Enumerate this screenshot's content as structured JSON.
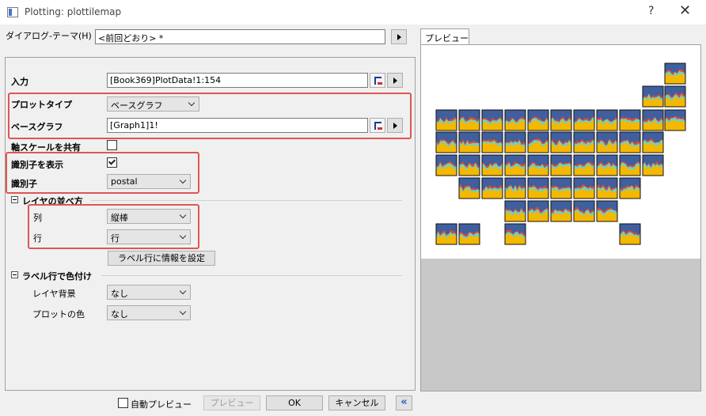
{
  "window": {
    "title": "Plotting: plottilemap",
    "help": "?",
    "close": "✕"
  },
  "dialog_theme": {
    "label": "ダイアログ-テーマ(H)",
    "value": "<前回どおり> *"
  },
  "input": {
    "label": "入力",
    "value": "[Book369]PlotData!1:154"
  },
  "plot_type": {
    "label": "プロットタイプ",
    "value": "ベースグラフ"
  },
  "base_graph": {
    "label": "ベースグラフ",
    "value": "[Graph1]1!"
  },
  "share_scale": {
    "label": "軸スケールを共有",
    "checked": false
  },
  "show_identifier": {
    "label": "識別子を表示",
    "checked": true
  },
  "identifier": {
    "label": "識別子",
    "value": "postal"
  },
  "layer_arrange": {
    "heading": "レイヤの並べ方",
    "column_label": "列",
    "column_value": "縦棒",
    "row_label": "行",
    "row_value": "行",
    "set_info_button": "ラベル行に情報を設定"
  },
  "label_color": {
    "heading": "ラベル行で色付け",
    "layer_bg_label": "レイヤ背景",
    "layer_bg_value": "なし",
    "plot_color_label": "プロットの色",
    "plot_color_value": "なし"
  },
  "footer": {
    "auto_preview": "自動プレビュー",
    "preview_button": "プレビュー",
    "ok_button": "OK",
    "cancel_button": "キャンセル",
    "collapse": "«"
  },
  "preview": {
    "tab": "プレビュー"
  },
  "colors": {
    "highlight": "#e05555",
    "tile_blue": "#3f5f9e",
    "tile_orange": "#f5b800",
    "tile_teal": "#6fd0c0",
    "tile_red": "#d84a3a"
  }
}
